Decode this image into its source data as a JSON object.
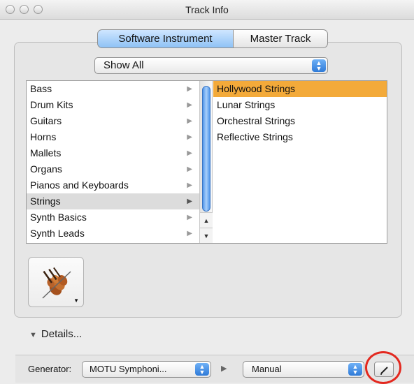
{
  "window": {
    "title": "Track Info"
  },
  "tabs": [
    {
      "label": "Software Instrument",
      "selected": true
    },
    {
      "label": "Master Track",
      "selected": false
    }
  ],
  "filter": {
    "value": "Show All"
  },
  "categories": [
    {
      "label": "Bass"
    },
    {
      "label": "Drum Kits"
    },
    {
      "label": "Guitars"
    },
    {
      "label": "Horns"
    },
    {
      "label": "Mallets"
    },
    {
      "label": "Organs"
    },
    {
      "label": "Pianos and Keyboards"
    },
    {
      "label": "Strings",
      "selected": true
    },
    {
      "label": "Synth Basics"
    },
    {
      "label": "Synth Leads"
    }
  ],
  "instruments": [
    {
      "label": "Hollywood Strings",
      "selected": true
    },
    {
      "label": "Lunar Strings"
    },
    {
      "label": "Orchestral Strings"
    },
    {
      "label": "Reflective Strings"
    }
  ],
  "details": {
    "label": "Details..."
  },
  "generator": {
    "label": "Generator:",
    "value": "MOTU Symphoni..."
  },
  "preset": {
    "value": "Manual"
  },
  "colors": {
    "selection_orange": "#f3aa3a",
    "highlight_red": "#e3281f",
    "accent_blue": "#4f95ea"
  }
}
